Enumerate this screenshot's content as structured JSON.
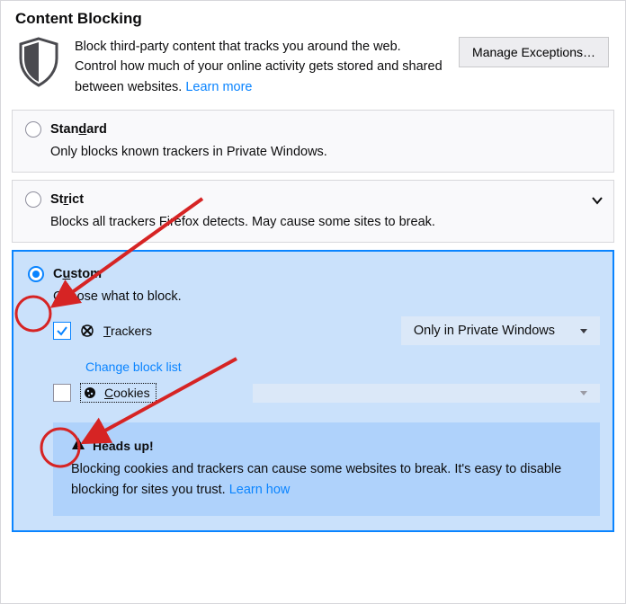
{
  "title": "Content Blocking",
  "intro": {
    "text": "Block third-party content that tracks you around the web. Control how much of your online activity gets stored and shared between websites.  ",
    "learn_more": "Learn more"
  },
  "manage_exceptions_label": "Manage Exceptions…",
  "options": {
    "standard": {
      "label_prefix": "Stan",
      "label_ul": "d",
      "label_suffix": "ard",
      "desc": "Only blocks known trackers in Private Windows."
    },
    "strict": {
      "label_prefix": "St",
      "label_ul": "r",
      "label_suffix": "ict",
      "desc": "Blocks all trackers Firefox detects. May cause some sites to break."
    },
    "custom": {
      "label_prefix": "C",
      "label_ul": "u",
      "label_suffix": "stom",
      "desc": "Choose what to block.",
      "trackers": {
        "label_ul": "T",
        "label_suffix": "rackers",
        "checked": true,
        "dropdown_value": "Only in Private Windows",
        "change_block_list": "Change block list"
      },
      "cookies": {
        "label_ul": "C",
        "label_suffix": "ookies",
        "checked": false
      },
      "info": {
        "heading": "Heads up!",
        "body": "Blocking cookies and trackers can cause some websites to break. It's easy to disable blocking for sites you trust.  ",
        "learn_how": "Learn how"
      }
    }
  },
  "selected": "custom"
}
